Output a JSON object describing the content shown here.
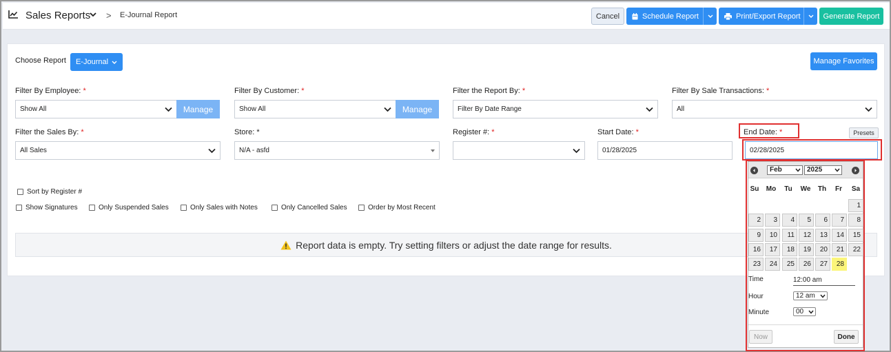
{
  "header": {
    "title": "Sales Reports",
    "breadcrumb_separator": ">",
    "breadcrumb": "E-Journal Report",
    "cancel_label": "Cancel",
    "schedule_label": "Schedule Report",
    "print_label": "Print/Export Report",
    "generate_label": "Generate Report",
    "colors": {
      "primary": "#2f8ef3",
      "generate": "#19c0a0"
    }
  },
  "report": {
    "choose_label": "Choose Report",
    "selected": "E-Journal",
    "manage_favorites": "Manage Favorites"
  },
  "filters": {
    "employee": {
      "label": "Filter By Employee:",
      "value": "Show All",
      "manage": "Manage"
    },
    "customer": {
      "label": "Filter By Customer:",
      "value": "Show All",
      "manage": "Manage"
    },
    "report_by": {
      "label": "Filter the Report By:",
      "value": "Filter By Date Range"
    },
    "sale_transactions": {
      "label": "Filter By Sale Transactions:",
      "value": "All"
    },
    "sales_by": {
      "label": "Filter the Sales By:",
      "value": "All Sales"
    },
    "store": {
      "label": "Store:",
      "value": "N/A - asfd"
    },
    "register": {
      "label": "Register #:",
      "value": ""
    },
    "start_date": {
      "label": "Start Date:",
      "value": "01/28/2025"
    },
    "end_date": {
      "label": "End Date:",
      "value": "02/28/2025"
    },
    "presets": "Presets",
    "required_mark": "*"
  },
  "options": {
    "sort_by_register": "Sort by Register #",
    "show_signatures": "Show Signatures",
    "only_suspended": "Only Suspended Sales",
    "only_notes": "Only Sales with Notes",
    "only_cancelled": "Only Cancelled Sales",
    "order_recent": "Order by Most Recent"
  },
  "notice": {
    "icon": "warning-icon",
    "text": "Report data is empty. Try setting filters or adjust the date range for results."
  },
  "calendar": {
    "month": "Feb",
    "year": "2025",
    "weekdays": [
      "Su",
      "Mo",
      "Tu",
      "We",
      "Th",
      "Fr",
      "Sa"
    ],
    "days": [
      "1",
      "2",
      "3",
      "4",
      "5",
      "6",
      "7",
      "8",
      "9",
      "10",
      "11",
      "12",
      "13",
      "14",
      "15",
      "16",
      "17",
      "18",
      "19",
      "20",
      "21",
      "22",
      "23",
      "24",
      "25",
      "26",
      "27",
      "28"
    ],
    "first_weekday_index": 6,
    "selected_day": "28",
    "time_label": "Time",
    "time_value": "12:00 am",
    "hour_label": "Hour",
    "hour_value": "12 am",
    "minute_label": "Minute",
    "minute_value": "00",
    "now_label": "Now",
    "done_label": "Done"
  }
}
